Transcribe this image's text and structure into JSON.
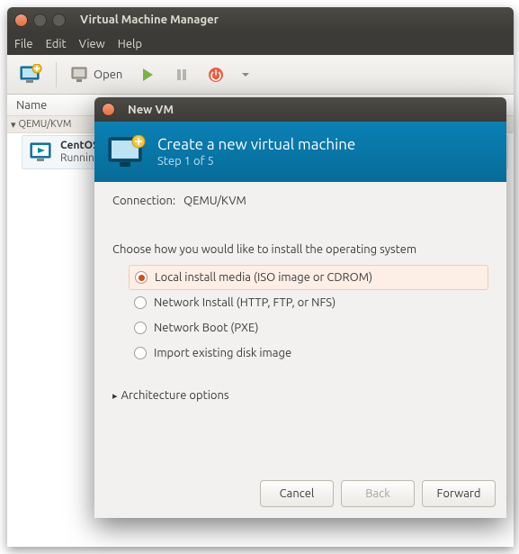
{
  "main_window": {
    "title": "Virtual Machine Manager",
    "menu": {
      "file": "File",
      "edit": "Edit",
      "view": "View",
      "help": "Help"
    },
    "toolbar": {
      "open": "Open"
    },
    "list": {
      "header": "Name",
      "group": {
        "label": "QEMU/KVM",
        "expander": "▾"
      },
      "vm": {
        "name": "CentOS",
        "state": "Running"
      }
    }
  },
  "dialog": {
    "title": "New VM",
    "header": {
      "title": "Create a new virtual machine",
      "step": "Step 1 of 5"
    },
    "connection": {
      "label": "Connection:",
      "value": "QEMU/KVM"
    },
    "choose_msg": "Choose how you would like to install the operating system",
    "options": {
      "local": "Local install media (ISO image or CDROM)",
      "net_install": "Network Install (HTTP, FTP, or NFS)",
      "net_boot": "Network Boot (PXE)",
      "import_disk": "Import existing disk image"
    },
    "arch": {
      "expander": "▸",
      "label": "Architecture options"
    },
    "buttons": {
      "cancel": "Cancel",
      "back": "Back",
      "forward": "Forward"
    }
  }
}
